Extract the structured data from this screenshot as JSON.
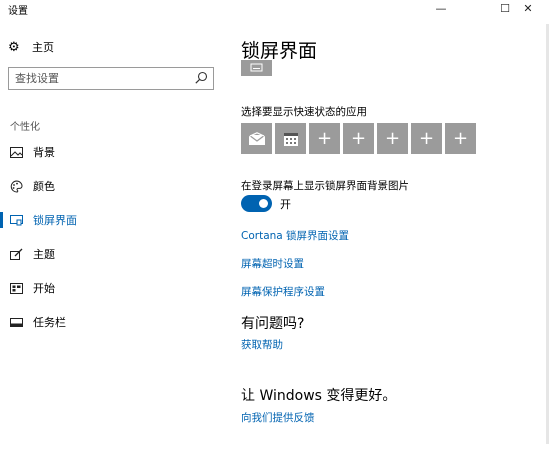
{
  "window": {
    "title": "设置",
    "minimize_glyph": "—",
    "maximize_glyph": "☐",
    "close_glyph": "✕"
  },
  "sidebar": {
    "home_label": "主页",
    "search_placeholder": "查找设置",
    "section_label": "个性化",
    "items": [
      {
        "label": "背景",
        "icon": "picture-icon"
      },
      {
        "label": "颜色",
        "icon": "palette-icon"
      },
      {
        "label": "锁屏界面",
        "icon": "lock-screen-icon",
        "active": true
      },
      {
        "label": "主题",
        "icon": "brush-icon"
      },
      {
        "label": "开始",
        "icon": "start-icon"
      },
      {
        "label": "任务栏",
        "icon": "taskbar-icon"
      }
    ]
  },
  "main": {
    "title": "锁屏界面",
    "quick_status_heading": "选择要显示快速状态的应用",
    "quick_status_tiles": [
      {
        "icon": "mail-icon",
        "glyph": ""
      },
      {
        "icon": "calendar-icon",
        "glyph": ""
      },
      {
        "icon": "plus-icon",
        "glyph": "+"
      },
      {
        "icon": "plus-icon",
        "glyph": "+"
      },
      {
        "icon": "plus-icon",
        "glyph": "+"
      },
      {
        "icon": "plus-icon",
        "glyph": "+"
      },
      {
        "icon": "plus-icon",
        "glyph": "+"
      }
    ],
    "bg_setting_heading": "在登录屏幕上显示锁屏界面背景图片",
    "toggle_state": "开",
    "toggle_on": true,
    "links": {
      "cortana": "Cortana 锁屏界面设置",
      "timeout": "屏幕超时设置",
      "screensaver": "屏幕保护程序设置"
    },
    "help": {
      "heading": "有问题吗?",
      "link": "获取帮助"
    },
    "feedback": {
      "heading": "让 Windows 变得更好。",
      "link": "向我们提供反馈"
    }
  },
  "colors": {
    "accent": "#0063b1",
    "tile_gray": "#9b9b9b"
  }
}
